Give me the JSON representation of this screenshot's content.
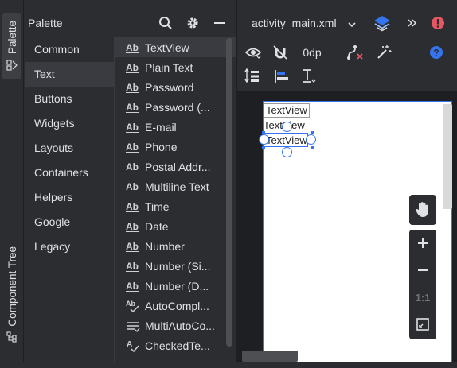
{
  "left_strip": {
    "palette_tab": "Palette",
    "component_tree_tab": "Component Tree"
  },
  "palette": {
    "title": "Palette",
    "categories": [
      "Common",
      "Text",
      "Buttons",
      "Widgets",
      "Layouts",
      "Containers",
      "Helpers",
      "Google",
      "Legacy"
    ],
    "selected_category": "Text",
    "items": [
      {
        "label": "TextView",
        "icon": "ab-icon"
      },
      {
        "label": "Plain Text",
        "icon": "ab-icon"
      },
      {
        "label": "Password",
        "icon": "ab-icon"
      },
      {
        "label": "Password (...",
        "icon": "ab-icon"
      },
      {
        "label": "E-mail",
        "icon": "ab-icon"
      },
      {
        "label": "Phone",
        "icon": "ab-icon"
      },
      {
        "label": "Postal Addr...",
        "icon": "ab-icon"
      },
      {
        "label": "Multiline Text",
        "icon": "ab-icon"
      },
      {
        "label": "Time",
        "icon": "ab-icon"
      },
      {
        "label": "Date",
        "icon": "ab-icon"
      },
      {
        "label": "Number",
        "icon": "ab-icon"
      },
      {
        "label": "Number (Si...",
        "icon": "ab-icon"
      },
      {
        "label": "Number (D...",
        "icon": "ab-icon"
      },
      {
        "label": "AutoCompl...",
        "icon": "ab-check-icon"
      },
      {
        "label": "MultiAutoCo...",
        "icon": "multi-line-icon"
      },
      {
        "label": "CheckedTe...",
        "icon": "a-check-icon"
      }
    ]
  },
  "editor": {
    "file_tab": "activity_main.xml",
    "default_margin": "0dp",
    "canvas_views": [
      "TextView",
      "TextView",
      "TextView"
    ],
    "zoom_actual_size": "1:1"
  },
  "colors": {
    "accent": "#3574f0",
    "error": "#e55765",
    "background": "#2b2d30",
    "selection": "#393b40"
  }
}
